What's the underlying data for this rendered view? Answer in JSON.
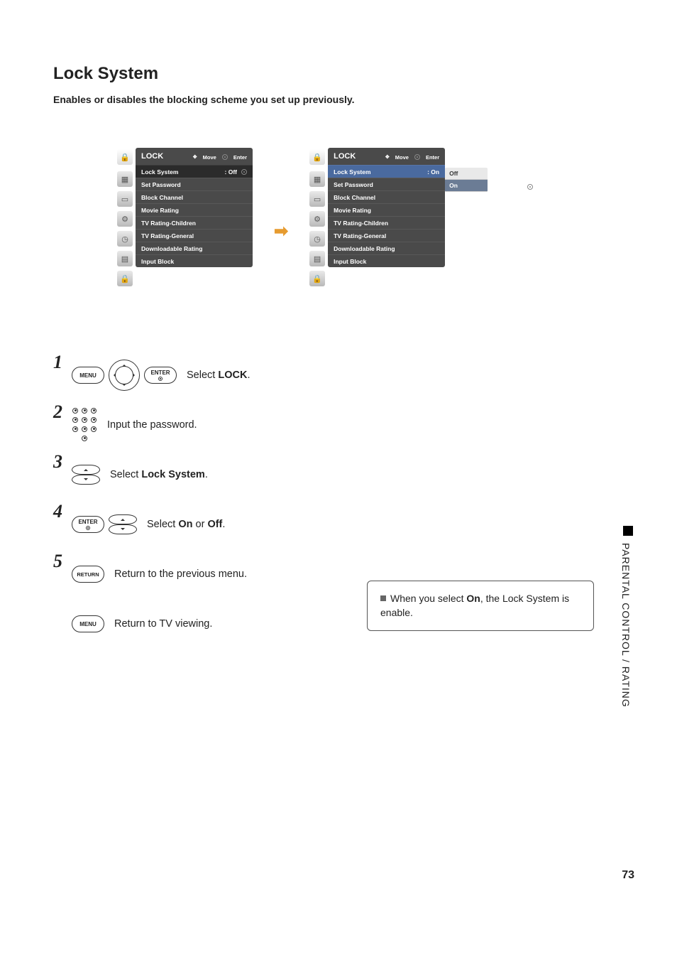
{
  "title": "Lock System",
  "subtitle": "Enables or disables the blocking scheme you set up previously.",
  "side_label": "PARENTAL CONTROL / RATING",
  "page_number": "73",
  "osd": {
    "header_title": "LOCK",
    "header_move": "Move",
    "header_enter": "Enter",
    "items": [
      "Lock System",
      "Set Password",
      "Block Channel",
      "Movie Rating",
      "TV Rating-Children",
      "TV Rating-General",
      "Downloadable Rating",
      "Input Block"
    ],
    "panel1_value": ": Off",
    "panel2_value": ": On",
    "submenu": {
      "off": "Off",
      "on": "On"
    }
  },
  "buttons": {
    "menu": "MENU",
    "enter": "ENTER",
    "return": "RETURN"
  },
  "steps": {
    "s1": {
      "num": "1",
      "pre": "Select ",
      "bold": "LOCK",
      "post": "."
    },
    "s2": {
      "num": "2",
      "text": "Input the password."
    },
    "s3": {
      "num": "3",
      "pre": "Select ",
      "bold": "Lock System",
      "post": "."
    },
    "s4": {
      "num": "4",
      "pre": "Select ",
      "bold1": "On",
      "mid": " or ",
      "bold2": "Off",
      "post": "."
    },
    "s5": {
      "num": "5",
      "text": "Return to the previous menu."
    },
    "sMenu": {
      "text": "Return to TV viewing."
    }
  },
  "note": {
    "pre": "When you select ",
    "bold": "On",
    "post": ", the Lock System is enable."
  }
}
